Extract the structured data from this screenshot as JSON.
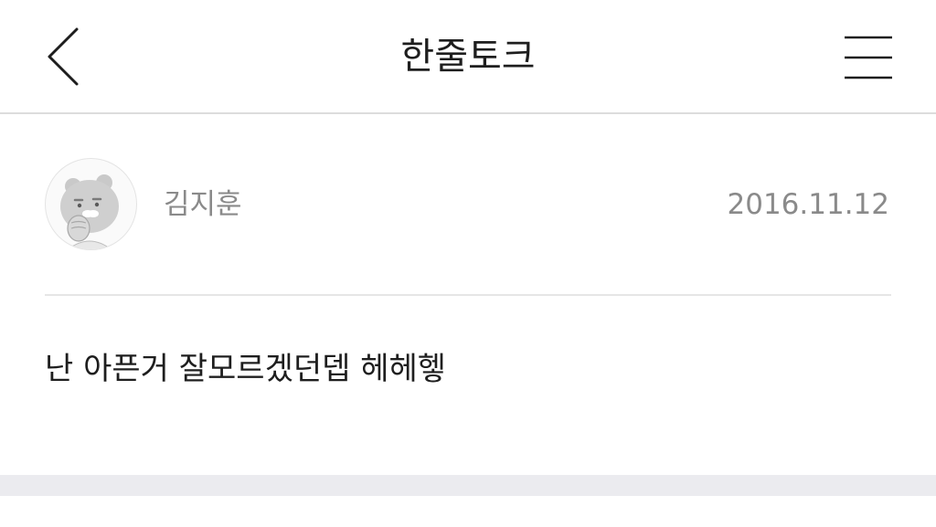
{
  "header": {
    "title": "한줄토크",
    "back_icon": "chevron-left-icon",
    "menu_icon": "hamburger-menu-icon"
  },
  "post": {
    "author": "김지훈",
    "date": "2016.11.12",
    "avatar_icon": "ryan-character-avatar-icon",
    "body": "난 아픈거 잘모르겠던뎁 헤헤헿"
  },
  "colors": {
    "text_primary": "#1e1e1e",
    "text_secondary": "#8a8a8a",
    "divider": "#dcdcdc",
    "band": "#ebebef"
  }
}
